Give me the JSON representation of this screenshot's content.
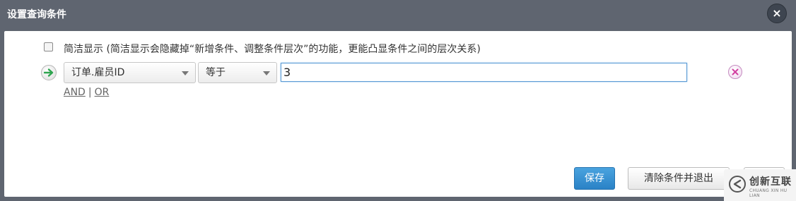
{
  "dialog": {
    "title": "设置查询条件",
    "close_label": "×"
  },
  "simple_display": {
    "checked": false,
    "label": "简洁显示 (简洁显示会隐藏掉“新增条件、调整条件层次”的功能，更能凸显条件之间的层次关系)"
  },
  "condition": {
    "field": "订单.雇员ID",
    "operator": "等于",
    "value": "3"
  },
  "logic": {
    "and_label": "AND",
    "separator": "|",
    "or_label": "OR"
  },
  "buttons": {
    "save": "保存",
    "clear_exit": "清除条件并退出"
  },
  "watermark": {
    "text": "创新互联",
    "subtext": "CHUANG XIN HU LIAN"
  },
  "icons": {
    "add_condition": "arrow-right-icon",
    "remove_condition": "remove-x-icon",
    "accent_green": "#2ea44f",
    "accent_remove": "#d13fa1",
    "primary_blue": "#2a82c6"
  }
}
